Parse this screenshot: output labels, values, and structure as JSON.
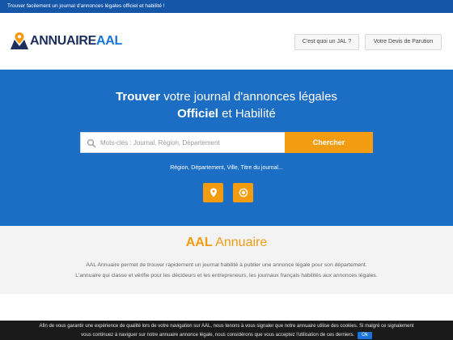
{
  "topbar": {
    "text": "Trouver facilement un journal d'annonces légales officiel et habilité !"
  },
  "logo": {
    "part1": "ANNUAIRE",
    "part2": "AAL"
  },
  "nav": {
    "jal": "C'est quoi un JAL ?",
    "devis": "Votre Devis de Parution"
  },
  "hero": {
    "line1_bold": "Trouver",
    "line1_rest": " votre journal d'annonces légales",
    "line2_bold": "Officiel",
    "line2_rest": " et Habilité",
    "search_placeholder": "Mots-clés : Journal, Région, Département",
    "search_button": "Chercher",
    "hint": "Région, Département, Ville, Titre du journal..."
  },
  "intro": {
    "title_a": "AAL",
    "title_b": " Annuaire",
    "p1": "AAL Annuaire permet de trouver rapidement un journal habilité à publier une annonce légale pour son département.",
    "p2": "L'annuaire qui classe et vérifie pour les décideurs et les entrepreneurs, les journaux français habilités aux annonces légales."
  },
  "cookie": {
    "line1": "Afin de vous garantir une expérience de qualité lors de votre navigation sur AAL, nous tenons à vous signaler que notre annuaire utilise des cookies. Si malgré ce signalement",
    "line2": "vous continuez à naviguer sur notre annuaire annonce légale, nous considérons que vous acceptez l'utilisation de ces derniers.",
    "ok": "Ok"
  },
  "icons": [
    "search-icon",
    "map-marker-icon",
    "target-icon",
    "logo-pin-icon"
  ],
  "colors": {
    "brand_blue": "#1b6ec4",
    "topbar_blue": "#1556a8",
    "accent_orange": "#f39c12",
    "logo_dark": "#1d2f5e"
  }
}
